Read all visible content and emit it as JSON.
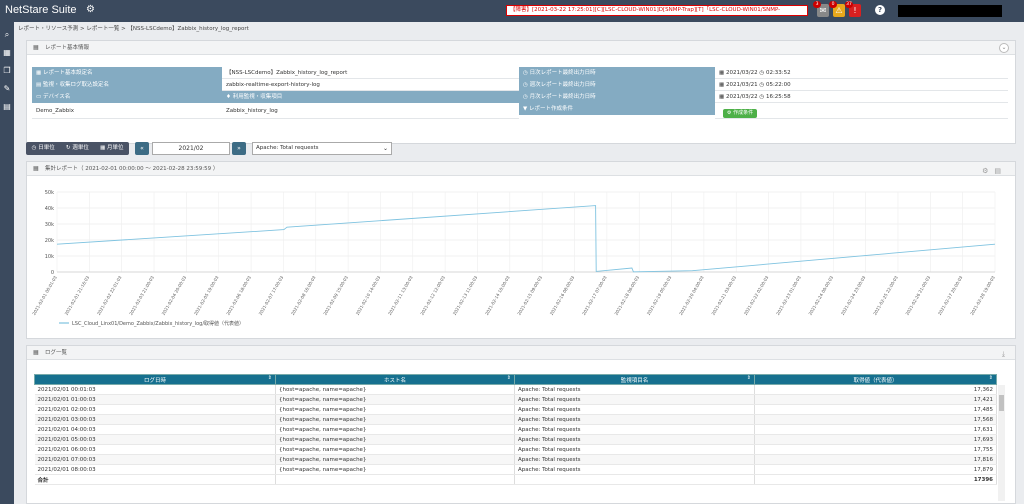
{
  "app": {
    "title": "NetStare Suite"
  },
  "topbar": {
    "alert_text": "【障害】[2021-03-22 17:25:01][C][LSC-CLOUD-WIN01]D[SNMP-Trap][T]「LSC-CLOUD-WIN01/SNMP-",
    "badges": [
      "3",
      "0",
      "37"
    ]
  },
  "breadcrumb": "レポート・リソース予測 > レポート一覧 > 【NSS-LSCdemo】Zabbix_history_log_report",
  "info": {
    "title": "レポート基本情報",
    "labels": {
      "report_name": "レポート基本設定名",
      "collect_name": "監視・収集ログ取込設定名",
      "device": "デバイス名",
      "item": "利用監視・収集項目",
      "daily": "日次レポート最終出力日時",
      "weekly": "週次レポート最終出力日時",
      "monthly": "月次レポート最終出力日時",
      "condition": "レポート作成条件"
    },
    "values": {
      "report_name": "【NSS-LSCdemo】Zabbix_history_log_report",
      "collect_name": "zabbix-realtime-export-history-log",
      "device": "Demo_Zabbix",
      "item": "Zabbix_history_log",
      "daily_date": "2021/03/22",
      "daily_time": "02:33:52",
      "weekly_date": "2021/03/21",
      "weekly_time": "05:22:00",
      "monthly_date": "2021/03/22",
      "monthly_time": "16:25:58",
      "condition_btn": "作成条件"
    }
  },
  "controls": {
    "day": "日単位",
    "week": "週単位",
    "month": "月単位",
    "period": "2021/02",
    "item_selected": "Apache: Total requests"
  },
  "chart_panel": {
    "title": "集計レポート（ 2021-02-01 00:00:00 ～ 2021-02-28 23:59:59 ）"
  },
  "chart_data": {
    "type": "line",
    "ylim": [
      0,
      50000
    ],
    "yticks": [
      "0",
      "10k",
      "20k",
      "30k",
      "40k",
      "50k"
    ],
    "xticks": [
      "2021-02-01 00:01:03",
      "2021-02-01 21:16:03",
      "2021-02-02 22:01:03",
      "2021-02-03 21:00:03",
      "2021-02-04 20:00:03",
      "2021-02-05 19:00:03",
      "2021-02-06 18:00:03",
      "2021-02-07 17:00:03",
      "2021-02-08 16:00:03",
      "2021-02-09 15:00:03",
      "2021-02-10 14:00:03",
      "2021-02-11 13:00:03",
      "2021-02-12 12:00:03",
      "2021-02-13 11:00:03",
      "2021-02-14 10:00:03",
      "2021-02-15 09:00:03",
      "2021-02-16 08:00:03",
      "2021-02-17 07:00:03",
      "2021-02-18 06:00:03",
      "2021-02-19 05:00:03",
      "2021-02-20 04:00:03",
      "2021-02-21 03:00:03",
      "2021-02-22 02:00:03",
      "2021-02-23 01:00:03",
      "2021-02-24 00:00:03",
      "2021-02-24 23:00:03",
      "2021-02-25 22:00:03",
      "2021-02-26 21:00:03",
      "2021-02-27 20:00:03",
      "2021-02-28 19:00:03"
    ],
    "series": [
      {
        "name": "LSC_Cloud_Linx01/Demo_Zabbix/Zabbix_history_log/取得値（代表値）",
        "color": "#7fc3e0",
        "points": [
          [
            0,
            17362
          ],
          [
            7.5,
            26500
          ],
          [
            7.6,
            28000
          ],
          [
            17.8,
            41500
          ],
          [
            17.82,
            400
          ],
          [
            19.0,
            2500
          ],
          [
            19.05,
            100
          ],
          [
            21.0,
            800
          ],
          [
            31.0,
            17396
          ]
        ],
        "x_range": [
          0,
          31
        ]
      }
    ],
    "grid": true,
    "legend": "bottom-left"
  },
  "log_panel": {
    "title": "ログ一覧",
    "headers": [
      "ログ日時",
      "ホスト名",
      "監視項目名",
      "取得値（代表値）"
    ],
    "rows": [
      [
        "2021/02/01 00:01:03",
        "{host=apache, name=apache}",
        "Apache: Total requests",
        "17,362"
      ],
      [
        "2021/02/01 01:00:03",
        "{host=apache, name=apache}",
        "Apache: Total requests",
        "17,421"
      ],
      [
        "2021/02/01 02:00:03",
        "{host=apache, name=apache}",
        "Apache: Total requests",
        "17,485"
      ],
      [
        "2021/02/01 03:00:03",
        "{host=apache, name=apache}",
        "Apache: Total requests",
        "17,568"
      ],
      [
        "2021/02/01 04:00:03",
        "{host=apache, name=apache}",
        "Apache: Total requests",
        "17,631"
      ],
      [
        "2021/02/01 05:00:03",
        "{host=apache, name=apache}",
        "Apache: Total requests",
        "17,693"
      ],
      [
        "2021/02/01 06:00:03",
        "{host=apache, name=apache}",
        "Apache: Total requests",
        "17,755"
      ],
      [
        "2021/02/01 07:00:03",
        "{host=apache, name=apache}",
        "Apache: Total requests",
        "17,816"
      ],
      [
        "2021/02/01 08:00:03",
        "{host=apache, name=apache}",
        "Apache: Total requests",
        "17,879"
      ]
    ],
    "total_label": "合計",
    "total_value": "17396"
  }
}
